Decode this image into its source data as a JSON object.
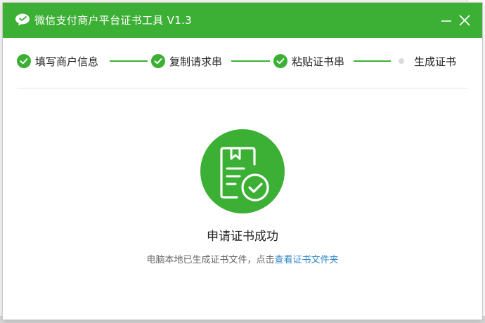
{
  "window": {
    "title": "微信支付商户平台证书工具 V1.3"
  },
  "steps": [
    {
      "label": "填写商户信息",
      "status": "done"
    },
    {
      "label": "复制请求串",
      "status": "done"
    },
    {
      "label": "粘贴证书串",
      "status": "done"
    },
    {
      "label": "生成证书",
      "status": "current"
    }
  ],
  "result": {
    "title": "申请证书成功",
    "description": "电脑本地已生成证书文件，点击",
    "link_label": "查看证书文件夹"
  },
  "colors": {
    "brand_green": "#3cb035",
    "link_blue": "#2f87c7"
  }
}
